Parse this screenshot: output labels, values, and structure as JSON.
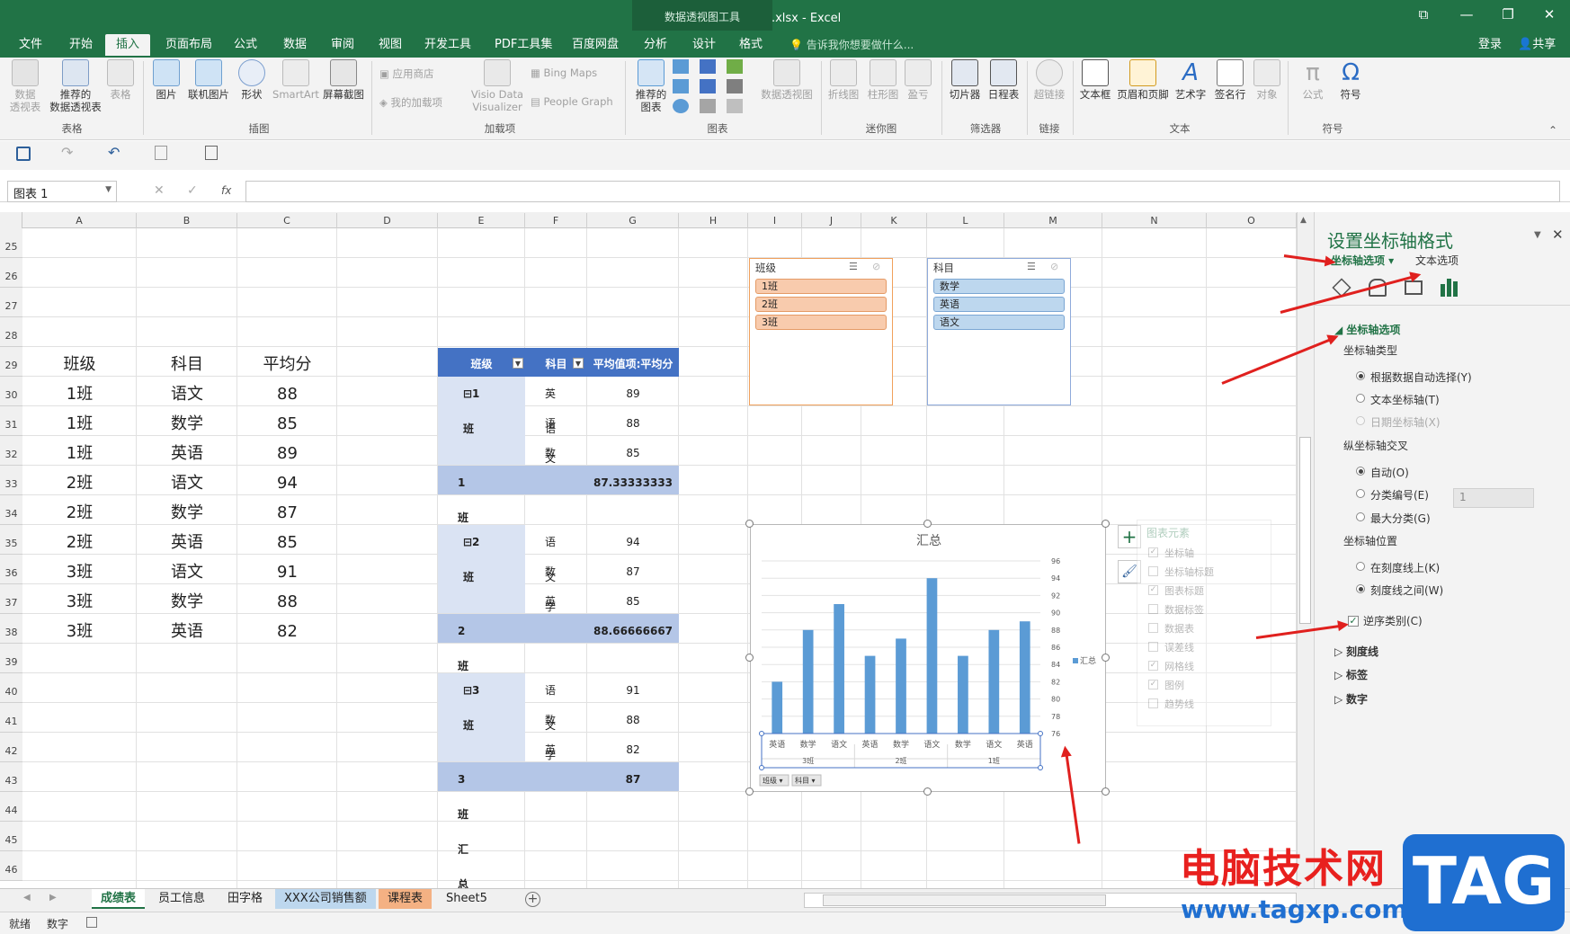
{
  "window": {
    "title": "工作簿3.xlsx - Excel",
    "context_tool": "数据透视图工具",
    "minimize": "—",
    "restore": "❐",
    "close": "✕",
    "ribbon_opt": "⧉"
  },
  "tabs": [
    "文件",
    "开始",
    "插入",
    "页面布局",
    "公式",
    "数据",
    "审阅",
    "视图",
    "开发工具",
    "PDF工具集",
    "百度网盘",
    "分析",
    "设计",
    "格式"
  ],
  "active_tab": "插入",
  "tellme": "告诉我你想要做什么...",
  "account": {
    "login": "登录",
    "share": "共享"
  },
  "ribbon": {
    "buttons": [
      "数据\n透视表",
      "推荐的\n数据透视表",
      "表格",
      "图片",
      "联机图片",
      "形状",
      "SmartArt",
      "屏幕截图",
      "推荐的\n图表",
      "数据透视图",
      "折线图",
      "柱形图",
      "盈亏",
      "切片器",
      "日程表",
      "超链接",
      "文本框",
      "页眉和页脚",
      "艺术字",
      "签名行",
      "对象",
      "公式",
      "符号"
    ],
    "small_buttons": [
      "应用商店",
      "我的加载项",
      "Visio Data\nVisualizer",
      "Bing Maps",
      "People Graph"
    ],
    "groups": [
      "表格",
      "插图",
      "加载项",
      "图表",
      "迷你图",
      "筛选器",
      "链接",
      "文本",
      "符号"
    ]
  },
  "namebox": "图表 1",
  "fx": "fx",
  "columns": [
    "A",
    "B",
    "C",
    "D",
    "E",
    "F",
    "G",
    "H",
    "I",
    "J",
    "K",
    "L",
    "M",
    "N",
    "O"
  ],
  "rows": [
    "25",
    "26",
    "27",
    "28",
    "29",
    "30",
    "31",
    "32",
    "33",
    "34",
    "35",
    "36",
    "37",
    "38",
    "39",
    "40",
    "41",
    "42",
    "43",
    "44",
    "45",
    "46"
  ],
  "source_table": {
    "headers": [
      "班级",
      "科目",
      "平均分"
    ],
    "rows": [
      [
        "1班",
        "语文",
        "88"
      ],
      [
        "1班",
        "数学",
        "85"
      ],
      [
        "1班",
        "英语",
        "89"
      ],
      [
        "2班",
        "语文",
        "94"
      ],
      [
        "2班",
        "数学",
        "87"
      ],
      [
        "2班",
        "英语",
        "85"
      ],
      [
        "3班",
        "语文",
        "91"
      ],
      [
        "3班",
        "数学",
        "88"
      ],
      [
        "3班",
        "英语",
        "82"
      ]
    ]
  },
  "pivot": {
    "headers": [
      "班级",
      "科目",
      "平均值项:平均分"
    ],
    "groups": [
      {
        "label": "⊟1班",
        "items": [
          [
            "英语",
            "89"
          ],
          [
            "语文",
            "88"
          ],
          [
            "数学",
            "85"
          ]
        ],
        "total_label": "1班 汇总",
        "total": "87.33333333"
      },
      {
        "label": "⊟2班",
        "items": [
          [
            "语文",
            "94"
          ],
          [
            "数学",
            "87"
          ],
          [
            "英语",
            "85"
          ]
        ],
        "total_label": "2班 汇总",
        "total": "88.66666667"
      },
      {
        "label": "⊟3班",
        "items": [
          [
            "语文",
            "91"
          ],
          [
            "数学",
            "88"
          ],
          [
            "英语",
            "82"
          ]
        ],
        "total_label": "3班 汇总",
        "total": "87"
      }
    ]
  },
  "slicers": [
    {
      "title": "班级",
      "items": [
        "1班",
        "2班",
        "3班"
      ]
    },
    {
      "title": "科目",
      "items": [
        "数学",
        "英语",
        "语文"
      ]
    }
  ],
  "chart_data": {
    "type": "bar",
    "title": "汇总",
    "categories": [
      "英语",
      "数学",
      "语文",
      "英语",
      "数学",
      "语文",
      "数学",
      "语文",
      "英语"
    ],
    "groups": [
      "3班",
      "2班",
      "1班"
    ],
    "series": [
      {
        "name": "汇总",
        "values": [
          82,
          88,
          91,
          85,
          87,
          94,
          85,
          88,
          89
        ]
      }
    ],
    "ylim": [
      76,
      96
    ],
    "yticks": [
      "96",
      "94",
      "92",
      "90",
      "88",
      "86",
      "84",
      "82",
      "80",
      "78",
      "76"
    ],
    "axis_side": "right",
    "legend": "right",
    "color": "#5b9bd5",
    "field_buttons": [
      "班级 ▾",
      "科目 ▾"
    ]
  },
  "chart_elements": {
    "title": "图表元素",
    "items": [
      [
        "坐标轴",
        true
      ],
      [
        "坐标轴标题",
        false
      ],
      [
        "图表标题",
        true
      ],
      [
        "数据标签",
        false
      ],
      [
        "数据表",
        false
      ],
      [
        "误差线",
        false
      ],
      [
        "网格线",
        true
      ],
      [
        "图例",
        true
      ],
      [
        "趋势线",
        false
      ]
    ]
  },
  "pane": {
    "title": "设置坐标轴格式",
    "tab_axis": "坐标轴选项 ▾",
    "tab_text": "文本选项",
    "section": "坐标轴选项",
    "axis_type_label": "坐标轴类型",
    "axis_type": [
      "根据数据自动选择(Y)",
      "文本坐标轴(T)",
      "日期坐标轴(X)"
    ],
    "cross_label": "纵坐标轴交叉",
    "cross": [
      "自动(O)",
      "分类编号(E)",
      "最大分类(G)"
    ],
    "cross_value": "1",
    "position_label": "坐标轴位置",
    "position": [
      "在刻度线上(K)",
      "刻度线之间(W)"
    ],
    "reverse": "逆序类别(C)",
    "collapsed": [
      "刻度线",
      "标签",
      "数字"
    ]
  },
  "sheets": [
    "成绩表",
    "员工信息",
    "田字格",
    "XXX公司销售额",
    "课程表",
    "Sheet5"
  ],
  "active_sheet": "成绩表",
  "status": {
    "ready": "就绪",
    "mode": "数字"
  },
  "watermark": {
    "site": "电脑技术网",
    "url": "www.tagxp.com",
    "logo": "TAG"
  }
}
